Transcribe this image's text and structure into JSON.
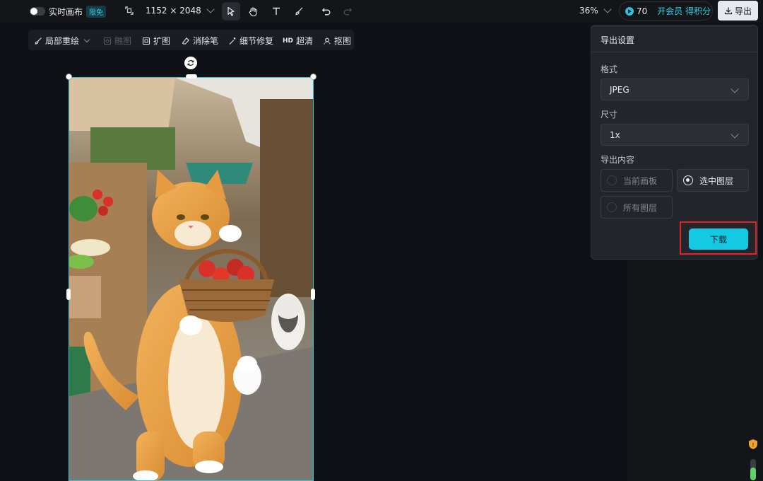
{
  "toolbar": {
    "realtime_label": "实时画布",
    "realtime_badge": "限免",
    "canvas_size": "1152 × 2048",
    "zoom": "36%",
    "points": "70",
    "vip_label": "开会员 得积分",
    "export_label": "导出"
  },
  "edit_tools": {
    "local_redraw": "局部重绘",
    "blend": "融图",
    "expand": "扩图",
    "eraser": "消除笔",
    "detail_fix": "细节修复",
    "hd_prefix": "HD",
    "hd": "超清",
    "cutout": "抠图"
  },
  "export_dialog": {
    "title": "导出设置",
    "format_label": "格式",
    "format_value": "JPEG",
    "size_label": "尺寸",
    "size_value": "1x",
    "content_label": "导出内容",
    "options": [
      {
        "label": "当前画板",
        "selected": false
      },
      {
        "label": "选中图层",
        "selected": true
      },
      {
        "label": "所有图层",
        "selected": false
      }
    ],
    "download_label": "下载"
  },
  "colors": {
    "accent": "#13c9e3",
    "highlight": "#e0242a",
    "selection": "#2ec8d8"
  }
}
